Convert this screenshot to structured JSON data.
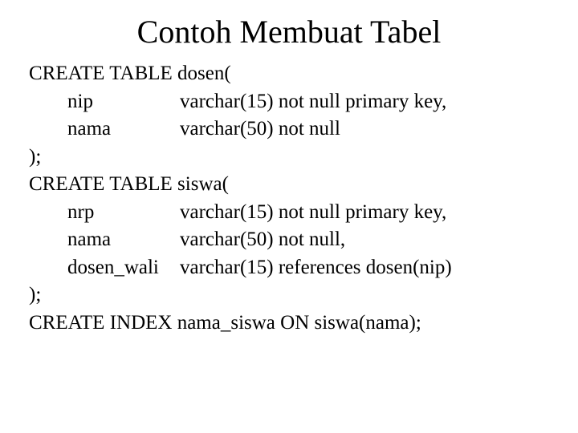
{
  "title": "Contoh Membuat Tabel",
  "lines": {
    "l0": "CREATE TABLE dosen(",
    "l1_name": "nip",
    "l1_def": "varchar(15) not null primary key,",
    "l2_name": "nama",
    "l2_def": "varchar(50) not null",
    "l3": ");",
    "l4": "CREATE TABLE siswa(",
    "l5_name": "nrp",
    "l5_def": "varchar(15) not null primary key,",
    "l6_name": "nama",
    "l6_def": "varchar(50) not null,",
    "l7_name": "dosen_wali",
    "l7_def": "varchar(15) references dosen(nip)",
    "l8": ");",
    "l9": "CREATE INDEX nama_siswa ON siswa(nama);"
  }
}
